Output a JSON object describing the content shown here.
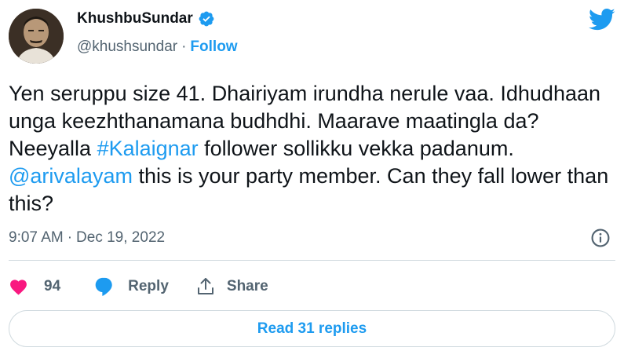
{
  "author": {
    "display_name": "KhushbuSundar",
    "handle": "@khushsundar",
    "separator": "·",
    "follow_label": "Follow"
  },
  "tweet": {
    "text_part1": "Yen seruppu size 41. Dhairiyam irundha nerule vaa. Idhudhaan unga keezhthanamana budhdhi. Maarave maatingla da? Neeyalla ",
    "hashtag": "#Kalaignar",
    "text_part2": " follower sollikku vekka padanum. ",
    "mention": "@arivalayam",
    "text_part3": " this is your party member. Can they fall lower than this?"
  },
  "meta": {
    "time": "9:07 AM",
    "separator": "·",
    "date": "Dec 19, 2022"
  },
  "actions": {
    "like_count": "94",
    "reply_label": "Reply",
    "share_label": "Share"
  },
  "read_replies_label": "Read 31 replies",
  "colors": {
    "brand_blue": "#1d9bf0",
    "like_red": "#f91880",
    "text_secondary": "#536471",
    "border": "#cfd9de"
  },
  "icons": [
    "verified-icon",
    "twitter-bird-icon",
    "info-icon",
    "heart-icon",
    "reply-bubble-icon",
    "share-icon"
  ]
}
